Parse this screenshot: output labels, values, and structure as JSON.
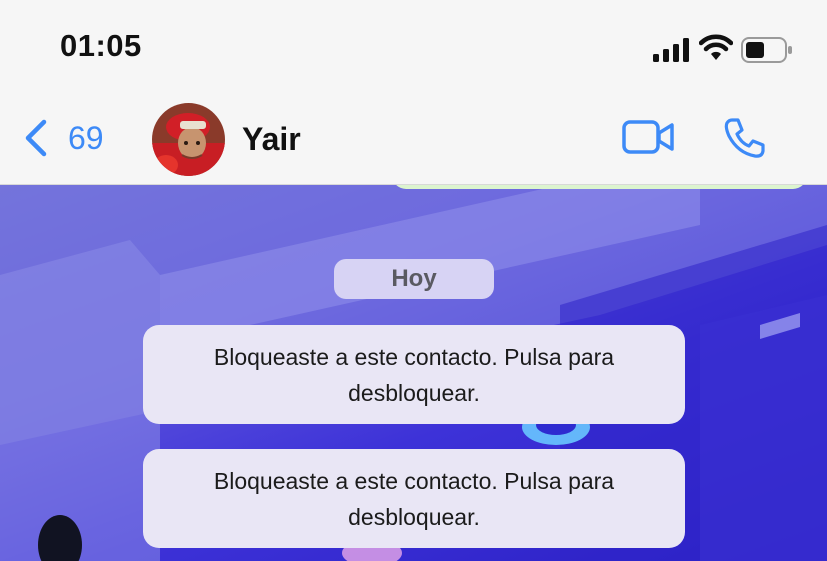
{
  "status": {
    "time": "01:05"
  },
  "header": {
    "back_count": "69",
    "contact_name": "Yair"
  },
  "chat": {
    "date_label": "Hoy",
    "messages": [
      {
        "text": "Bloqueaste a este contacto. Pulsa para desbloquear."
      },
      {
        "text": "Bloqueaste a este contacto. Pulsa para desbloquear."
      }
    ]
  },
  "colors": {
    "accent": "#3d8af7",
    "header_bg": "#f6f6f6",
    "bubble_bg": "#e9e6f5"
  }
}
